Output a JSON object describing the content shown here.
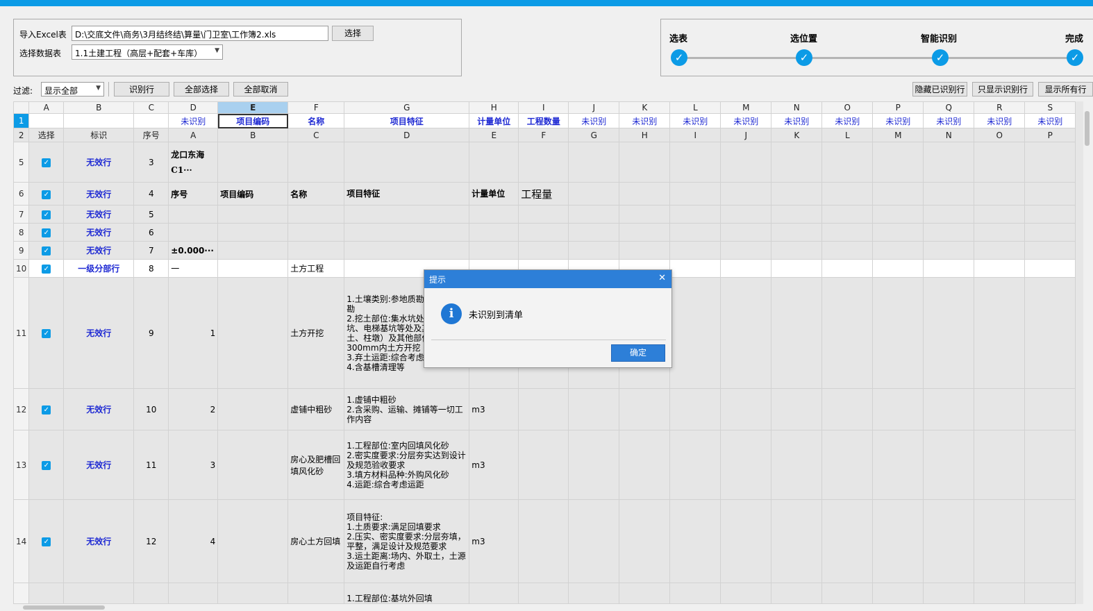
{
  "import": {
    "excel_label": "导入Excel表",
    "path": "D:\\交底文件\\商务\\3月结终结\\算量\\门卫室\\工作簿2.xls",
    "choose_button": "选择",
    "sheet_label": "选择数据表",
    "sheet_value": "1.1土建工程（高层+配套+车库）"
  },
  "steps": [
    {
      "label": "选表"
    },
    {
      "label": "选位置"
    },
    {
      "label": "智能识别"
    },
    {
      "label": "完成"
    }
  ],
  "toolbar": {
    "filter_label": "过滤:",
    "filter_value": "显示全部",
    "identify_row": "识别行",
    "select_all": "全部选择",
    "cancel_all": "全部取消",
    "hide_identified": "隐藏已识别行",
    "show_identified_only": "只显示识别行",
    "show_all_rows": "显示所有行"
  },
  "grid": {
    "columns": [
      "A",
      "B",
      "C",
      "D",
      "E",
      "F",
      "G",
      "H",
      "I",
      "J",
      "K",
      "L",
      "M",
      "N",
      "O",
      "P",
      "Q",
      "R",
      "S"
    ],
    "row1_num": "1",
    "row1": [
      "",
      "",
      "",
      "未识别",
      "项目编码",
      "名称",
      "项目特征",
      "计量单位",
      "工程数量",
      "未识别",
      "未识别",
      "未识别",
      "未识别",
      "未识别",
      "未识别",
      "未识别",
      "未识别",
      "未识别",
      "未识别"
    ],
    "row2_num": "2",
    "row2": [
      "选择",
      "标识",
      "序号",
      "A",
      "B",
      "C",
      "D",
      "E",
      "F",
      "G",
      "H",
      "I",
      "J",
      "K",
      "L",
      "M",
      "N",
      "O",
      "P"
    ],
    "rows": [
      {
        "rn": "5",
        "flag": "无效行",
        "seq": "3",
        "d": "龙口东海C1···",
        "f": "",
        "g": "",
        "h": "",
        "i": ""
      },
      {
        "rn": "6",
        "flag": "无效行",
        "seq": "4",
        "d": "序号",
        "e": "项目编码",
        "f": "名称",
        "g": "项目特征",
        "h": "计量单位",
        "i": "工程量"
      },
      {
        "rn": "7",
        "flag": "无效行",
        "seq": "5",
        "d": "",
        "f": "",
        "g": "",
        "h": "",
        "i": ""
      },
      {
        "rn": "8",
        "flag": "无效行",
        "seq": "6",
        "d": "",
        "f": "",
        "g": "",
        "h": "",
        "i": ""
      },
      {
        "rn": "9",
        "flag": "无效行",
        "seq": "7",
        "d": "±0.000···",
        "f": "",
        "g": "",
        "h": "",
        "i": ""
      },
      {
        "rn": "10",
        "flag": "一级分部行",
        "seq": "8",
        "d": "一",
        "f": "土方工程",
        "g": "",
        "h": "",
        "i": ""
      },
      {
        "rn": "11",
        "flag": "无效行",
        "seq": "9",
        "d": "1",
        "f": "土方开挖",
        "g": "1.土壤类别:参地质勘察及现场踏勘\n2.挖土部位:集水坑处（含集水坑、电梯基坑等处及其他部位土、柱墩）及其他部位标高以上300mm内土方开挖\n3.弃土运距:综合考虑\n4.含基槽清理等",
        "h": "",
        "i": ""
      },
      {
        "rn": "12",
        "flag": "无效行",
        "seq": "10",
        "d": "2",
        "f": "虚铺中粗砂",
        "g": "1.虚铺中粗砂\n2.含采购、运输、摊铺等一切工作内容",
        "h": "m3",
        "i": ""
      },
      {
        "rn": "13",
        "flag": "无效行",
        "seq": "11",
        "d": "3",
        "f": "房心及肥槽回填风化砂",
        "g": "1.工程部位:室内回填风化砂\n2.密实度要求:分层夯实达到设计及规范验收要求\n3.填方材料品种:外购风化砂\n4.运距:综合考虑运距",
        "h": "m3",
        "i": ""
      },
      {
        "rn": "14",
        "flag": "无效行",
        "seq": "12",
        "d": "4",
        "f": "房心土方回填",
        "g": "项目特征:\n1.土质要求:满足回填要求\n2.压实、密实度要求:分层夯填，平整，满足设计及规范要求\n3.运土距离:场内、外取土，土源及运距自行考虑",
        "h": "m3",
        "i": ""
      },
      {
        "rn": "",
        "flag": "",
        "seq": "",
        "d": "",
        "f": "",
        "g": "1.工程部位:基坑外回填",
        "h": "",
        "i": ""
      }
    ]
  },
  "dialog": {
    "title": "提示",
    "message": "未识别到清单",
    "ok": "确定"
  },
  "colors": {
    "accent": "#0c9be6",
    "dialog_title": "#2d7fd8",
    "flag_text": "#1f2ad3"
  }
}
